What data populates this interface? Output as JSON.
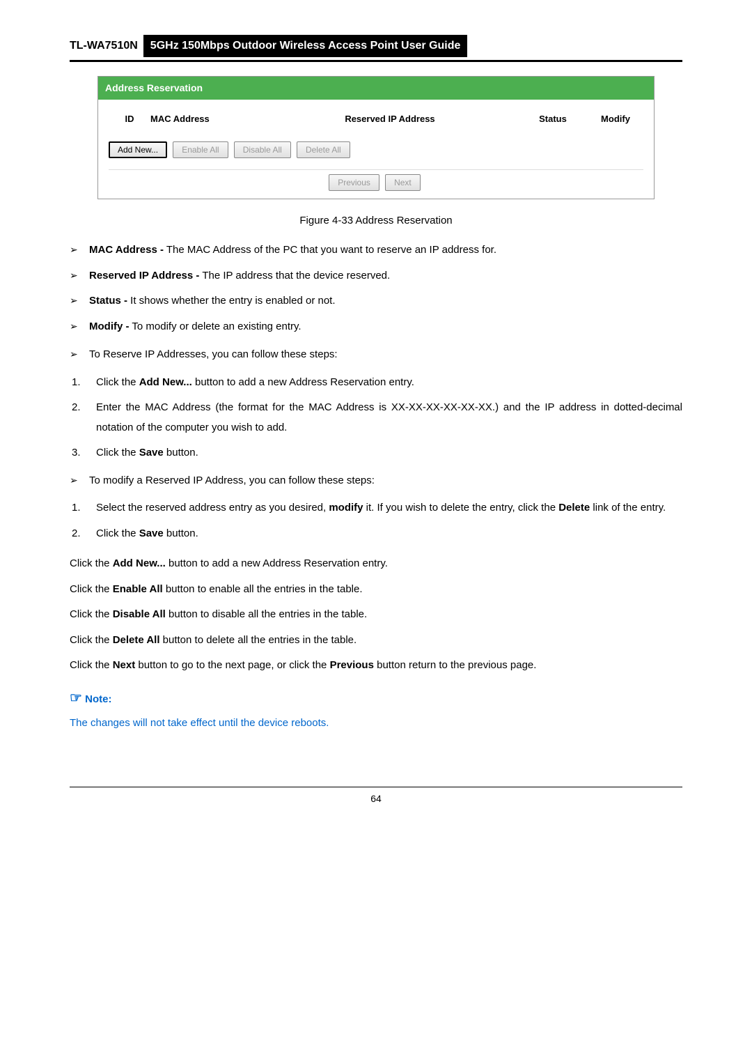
{
  "header": {
    "model": "TL-WA7510N",
    "title": "5GHz 150Mbps Outdoor Wireless Access Point User Guide"
  },
  "screenshot": {
    "title": "Address Reservation",
    "columns": {
      "id": "ID",
      "mac": "MAC Address",
      "ip": "Reserved IP Address",
      "status": "Status",
      "modify": "Modify"
    },
    "buttons": {
      "add_new": "Add New...",
      "enable_all": "Enable All",
      "disable_all": "Disable All",
      "delete_all": "Delete All",
      "previous": "Previous",
      "next": "Next"
    }
  },
  "figure_caption": "Figure 4-33 Address Reservation",
  "defs": {
    "mac_label": "MAC Address -",
    "mac_text": " The MAC Address of the PC that you want to reserve an IP address for.",
    "ip_label": "Reserved IP Address -",
    "ip_text": " The IP address that the device reserved.",
    "status_label": "Status -",
    "status_text": " It shows whether the entry is enabled or not.",
    "modify_label": "Modify -",
    "modify_text": " To modify or delete an existing entry."
  },
  "reserve_intro": "To Reserve IP Addresses, you can follow these steps:",
  "reserve_steps": {
    "s1a": "Click the ",
    "s1b": "Add New...",
    "s1c": " button to add a new Address Reservation entry.",
    "s2": "Enter the MAC Address (the format for the MAC Address is XX-XX-XX-XX-XX-XX.) and the IP address in dotted-decimal notation of the computer you wish to add.",
    "s3a": "Click the ",
    "s3b": "Save",
    "s3c": " button."
  },
  "modify_intro": "To modify a Reserved IP Address, you can follow these steps:",
  "modify_steps": {
    "s1a": "Select the reserved address entry as you desired, ",
    "s1b": "modify",
    "s1c": " it. If you wish to delete the entry, click the ",
    "s1d": "Delete",
    "s1e": " link of the entry.",
    "s2a": "Click the ",
    "s2b": "Save",
    "s2c": " button."
  },
  "actions": {
    "p1a": "Click the ",
    "p1b": "Add New...",
    "p1c": " button to add a new Address Reservation entry.",
    "p2a": "Click the ",
    "p2b": "Enable All",
    "p2c": " button to enable all the entries in the table.",
    "p3a": "Click the ",
    "p3b": "Disable All",
    "p3c": " button to disable all the entries in the table.",
    "p4a": "Click the ",
    "p4b": "Delete All",
    "p4c": " button to delete all the entries in the table.",
    "p5a": "Click the ",
    "p5b": "Next",
    "p5c": " button to go to the next page, or click the ",
    "p5d": "Previous",
    "p5e": " button return to the previous page."
  },
  "note": {
    "label": "Note:",
    "text": "The changes will not take effect until the device reboots."
  },
  "page_number": "64",
  "markers": {
    "bullet": "➢",
    "hand": "☞"
  }
}
